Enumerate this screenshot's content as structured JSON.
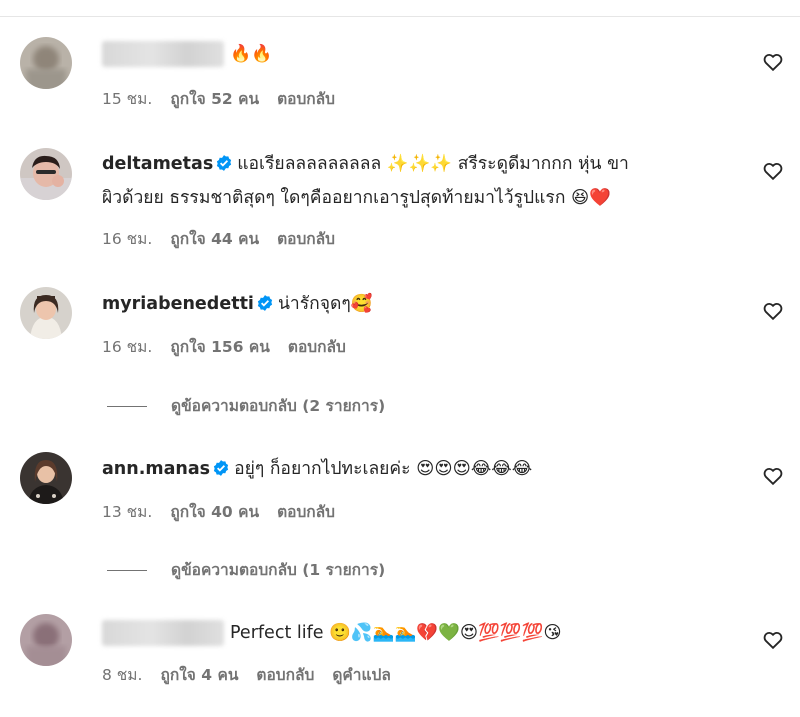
{
  "comments": [
    {
      "username": "",
      "username_blurred": true,
      "verified": false,
      "text": "",
      "emojis": "🔥🔥",
      "time": "15 ชม.",
      "likes": "ถูกใจ 52 คน",
      "reply": "ตอบกลับ",
      "translate": ""
    },
    {
      "username": "deltametas",
      "username_blurred": false,
      "verified": true,
      "text_line1": "แอเรียลลลลลลลลล ✨✨✨ สรีระดูดีมากกก หุ่น ขา",
      "text_line2": "ผิวด้วยย ธรรมชาติสุดๆ ใดๆคืออยากเอารูปสุดท้ายมาไว้รูปแรก 😆❤️",
      "time": "16 ชม.",
      "likes": "ถูกใจ 44 คน",
      "reply": "ตอบกลับ"
    },
    {
      "username": "myriabenedetti",
      "username_blurred": false,
      "verified": true,
      "text": "น่ารักจุดๆ🥰",
      "time": "16 ชม.",
      "likes": "ถูกใจ 156 คน",
      "reply": "ตอบกลับ",
      "view_replies": "ดูข้อความตอบกลับ (2 รายการ)"
    },
    {
      "username": "ann.manas",
      "username_blurred": false,
      "verified": true,
      "text": "อยู่ๆ ก็อยากไปทะเลยค่ะ 😍😍😍😂😂😂",
      "time": "13 ชม.",
      "likes": "ถูกใจ 40 คน",
      "reply": "ตอบกลับ",
      "view_replies": "ดูข้อความตอบกลับ (1 รายการ)"
    },
    {
      "username": "",
      "username_blurred": true,
      "verified": false,
      "text": "Perfect life 🙂💦🏊🏊💔💚😍💯💯💯😘",
      "time": "8 ชม.",
      "likes": "ถูกใจ 4 คน",
      "reply": "ตอบกลับ",
      "translate": "ดูคำแปล"
    }
  ],
  "icons": {
    "like": "heart-outline-icon",
    "verified": "verified-badge-icon"
  },
  "colors": {
    "verified": "#0095f6",
    "meta": "#737373",
    "text": "#262626"
  }
}
